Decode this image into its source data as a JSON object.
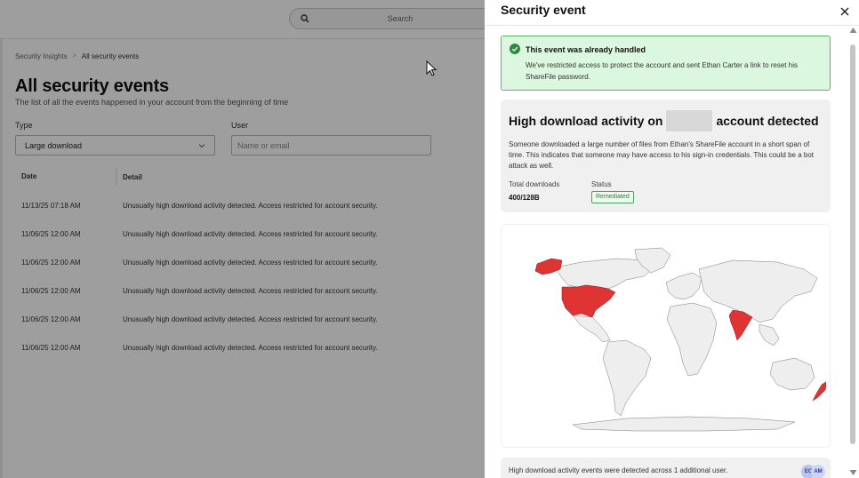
{
  "search": {
    "placeholder": "Search"
  },
  "breadcrumb": {
    "parent": "Security Insights",
    "current": "All security events"
  },
  "page": {
    "title": "All security events",
    "subtitle": "The list of all the events happened in your account from the beginning of time"
  },
  "filters": {
    "type_label": "Type",
    "type_value": "Large download",
    "user_label": "User",
    "user_placeholder": "Name or email"
  },
  "table": {
    "columns": [
      "Date",
      "Detail"
    ],
    "rows": [
      {
        "date": "11/13/25 07:18 AM",
        "detail": "Unusually high download activity detected. Access restricted for account security."
      },
      {
        "date": "11/06/25 12:00 AM",
        "detail": "Unusually high download activity detected. Access restricted for account security."
      },
      {
        "date": "11/06/25 12:00 AM",
        "detail": "Unusually high download activity detected. Access restricted for account security."
      },
      {
        "date": "11/06/25 12:00 AM",
        "detail": "Unusually high download activity detected. Access restricted for account security."
      },
      {
        "date": "11/06/25 12:00 AM",
        "detail": "Unusually high download activity detected. Access restricted for account security."
      },
      {
        "date": "11/06/25 12:00 AM",
        "detail": "Unusually high download activity detected. Access restricted for account security."
      }
    ]
  },
  "panel": {
    "title": "Security event",
    "alert": {
      "title": "This event was already handled",
      "body": "We've restricted access to protect the account and sent Ethan Carter a link to reset his ShareFile password."
    },
    "event": {
      "title_prefix": "High download activity on",
      "title_suffix": "account detected",
      "description": "Someone downloaded a large number of files from Ethan's ShareFile account in a short span of time. This indicates that someone may have access to his sign-in credentials. This could be a bot attack as well.",
      "downloads_label": "Total downloads",
      "downloads_value": "400/128B",
      "status_label": "Status",
      "status_value": "Remediated"
    },
    "footer": {
      "text": "High download activity events were detected across 1 additional user.",
      "avatars": [
        "EC",
        "AM"
      ]
    }
  },
  "colors": {
    "highlight_country": "#e03333",
    "land": "#eeeeee",
    "alert_bg": "#dcf7df",
    "alert_border": "#59b865",
    "status_green": "#2f7d3c"
  }
}
